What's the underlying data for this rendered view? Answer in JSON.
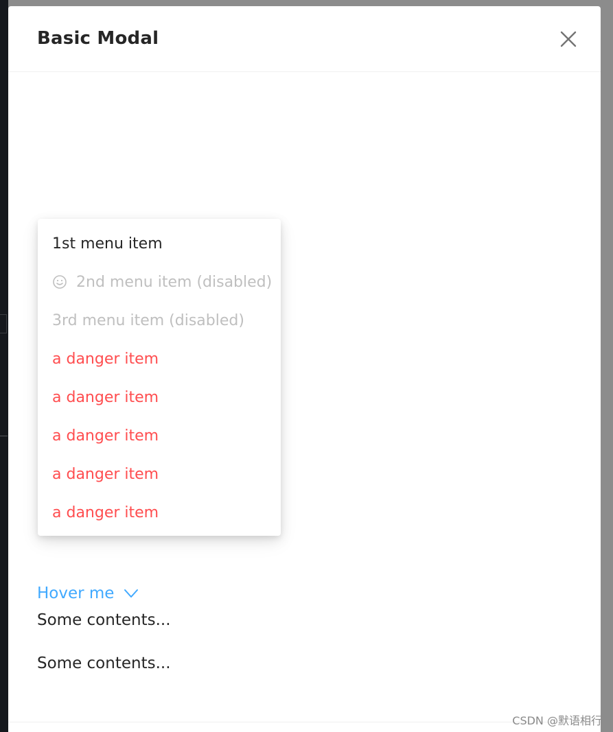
{
  "modal": {
    "title": "Basic Modal"
  },
  "dropdown": {
    "items": [
      {
        "label": "1st menu item",
        "state": "normal"
      },
      {
        "label": "2nd menu item (disabled)",
        "state": "disabled",
        "icon": "smile-icon"
      },
      {
        "label": "3rd menu item (disabled)",
        "state": "disabled"
      },
      {
        "label": "a danger item",
        "state": "danger"
      },
      {
        "label": "a danger item",
        "state": "danger"
      },
      {
        "label": "a danger item",
        "state": "danger"
      },
      {
        "label": "a danger item",
        "state": "danger"
      },
      {
        "label": "a danger item",
        "state": "danger"
      }
    ],
    "trigger_label": "Hover me",
    "trigger_icon": "chevron-down-icon"
  },
  "body": {
    "contents": [
      "Some contents...",
      "Some contents..."
    ]
  },
  "watermark": "CSDN @默语相行",
  "colors": {
    "primary": "#40a9ff",
    "danger": "#ff4d4f",
    "disabled": "#bfbfbf",
    "text": "#262626"
  }
}
